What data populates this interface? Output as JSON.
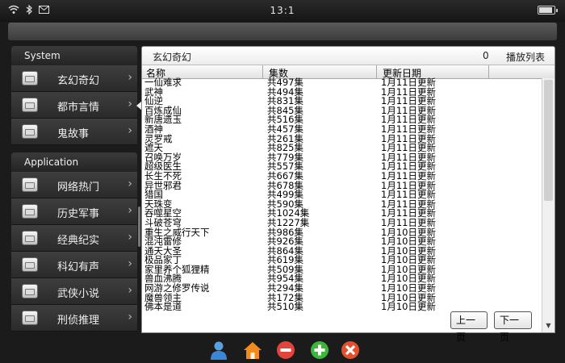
{
  "status": {
    "time": "13:1"
  },
  "sidebar": {
    "system_header": "System",
    "application_header": "Application",
    "system_items": [
      {
        "label": "玄幻奇幻"
      },
      {
        "label": "都市言情"
      },
      {
        "label": "鬼故事"
      }
    ],
    "app_items": [
      {
        "label": "网络热门"
      },
      {
        "label": "历史军事"
      },
      {
        "label": "经典纪实"
      },
      {
        "label": "科幻有声"
      },
      {
        "label": "武侠小说"
      },
      {
        "label": "刑侦推理"
      }
    ],
    "active_index": 1
  },
  "panel": {
    "title": "玄幻奇幻",
    "count": "0",
    "playlist_label": "播放列表",
    "columns": [
      "名称",
      "集数",
      "更新日期"
    ],
    "rows": [
      [
        "一仙难求",
        "共497集",
        "1月11日更新"
      ],
      [
        "武神",
        "共494集",
        "1月11日更新"
      ],
      [
        "仙逆",
        "共831集",
        "1月11日更新"
      ],
      [
        "百炼成仙",
        "共845集",
        "1月11日更新"
      ],
      [
        "新唐遗玉",
        "共516集",
        "1月11日更新"
      ],
      [
        "酒神",
        "共457集",
        "1月11日更新"
      ],
      [
        "灵罗戒",
        "共261集",
        "1月11日更新"
      ],
      [
        "遮天",
        "共825集",
        "1月11日更新"
      ],
      [
        "召唤万岁",
        "共779集",
        "1月11日更新"
      ],
      [
        "超级医生",
        "共557集",
        "1月11日更新"
      ],
      [
        "长生不死",
        "共667集",
        "1月11日更新"
      ],
      [
        "异世邪君",
        "共678集",
        "1月11日更新"
      ],
      [
        "猎国",
        "共499集",
        "1月11日更新"
      ],
      [
        "天珠变",
        "共590集",
        "1月11日更新"
      ],
      [
        "吞噬星空",
        "共1024集",
        "1月11日更新"
      ],
      [
        "斗破苍穹",
        "共1227集",
        "1月11日更新"
      ],
      [
        "重生之威行天下",
        "共986集",
        "1月10日更新"
      ],
      [
        "混沌雷修",
        "共926集",
        "1月10日更新"
      ],
      [
        "通天大圣",
        "共864集",
        "1月10日更新"
      ],
      [
        "极品家丁",
        "共619集",
        "1月10日更新"
      ],
      [
        "家里养个狐狸精",
        "共509集",
        "1月10日更新"
      ],
      [
        "兽血沸腾",
        "共954集",
        "1月10日更新"
      ],
      [
        "网游之修罗传说",
        "共294集",
        "1月10日更新"
      ],
      [
        "魔兽领主",
        "共172集",
        "1月10日更新"
      ],
      [
        "佛本是道",
        "共510集",
        "1月10日更新"
      ]
    ]
  },
  "pager": {
    "prev_label": "上一页",
    "next_label": "下一页"
  },
  "dock": [
    "user-icon",
    "home-icon",
    "minus-icon",
    "plus-icon",
    "close-icon"
  ]
}
